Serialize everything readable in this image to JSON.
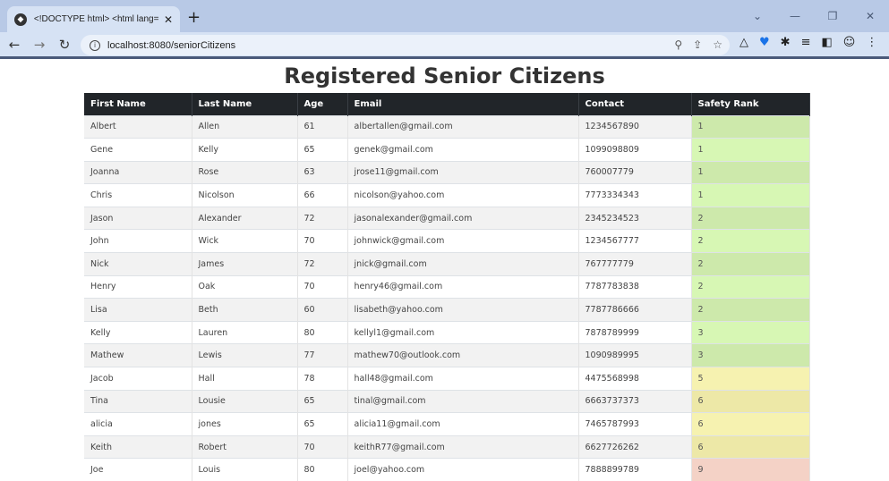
{
  "browser": {
    "tab_title": "<!DOCTYPE html> <html lang=",
    "url": "localhost:8080/seniorCitizens"
  },
  "page": {
    "title": "Registered Senior Citizens"
  },
  "table": {
    "headers": [
      "First Name",
      "Last Name",
      "Age",
      "Email",
      "Contact",
      "Safety Rank"
    ],
    "rows": [
      [
        "Albert",
        "Allen",
        "61",
        "albertallen@gmail.com",
        "1234567890",
        "1"
      ],
      [
        "Gene",
        "Kelly",
        "65",
        "genek@gmail.com",
        "1099098809",
        "1"
      ],
      [
        "Joanna",
        "Rose",
        "63",
        "jrose11@gmail.com",
        "760007779",
        "1"
      ],
      [
        "Chris",
        "Nicolson",
        "66",
        "nicolson@yahoo.com",
        "7773334343",
        "1"
      ],
      [
        "Jason",
        "Alexander",
        "72",
        "jasonalexander@gmail.com",
        "2345234523",
        "2"
      ],
      [
        "John",
        "Wick",
        "70",
        "johnwick@gmail.com",
        "1234567777",
        "2"
      ],
      [
        "Nick",
        "James",
        "72",
        "jnick@gmail.com",
        "767777779",
        "2"
      ],
      [
        "Henry",
        "Oak",
        "70",
        "henry46@gmail.com",
        "7787783838",
        "2"
      ],
      [
        "Lisa",
        "Beth",
        "60",
        "lisabeth@yahoo.com",
        "7787786666",
        "2"
      ],
      [
        "Kelly",
        "Lauren",
        "80",
        "kellyl1@gmail.com",
        "7878789999",
        "3"
      ],
      [
        "Mathew",
        "Lewis",
        "77",
        "mathew70@outlook.com",
        "1090989995",
        "3"
      ],
      [
        "Jacob",
        "Hall",
        "78",
        "hall48@gmail.com",
        "4475568998",
        "5"
      ],
      [
        "Tina",
        "Lousie",
        "65",
        "tinal@gmail.com",
        "6663737373",
        "6"
      ],
      [
        "alicia",
        "jones",
        "65",
        "alicia11@gmail.com",
        "7465787993",
        "6"
      ],
      [
        "Keith",
        "Robert",
        "70",
        "keithR77@gmail.com",
        "6627726262",
        "6"
      ],
      [
        "Joe",
        "Louis",
        "80",
        "joel@yahoo.com",
        "7888899789",
        "9"
      ]
    ]
  },
  "rank_colors": {
    "low": "#d7f7b4",
    "medium": "#f6f2b0",
    "high": "#f4d2c6"
  }
}
